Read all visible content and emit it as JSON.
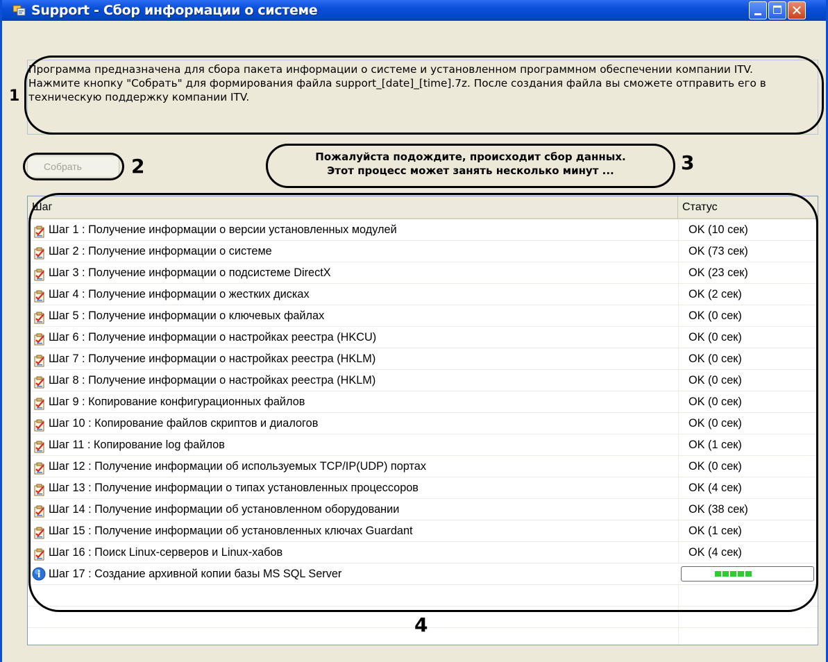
{
  "window": {
    "title": "Support - Сбор информации о системе"
  },
  "description": "Программа предназначена для сбора пакета информации о системе и установленном программном обеспечении компании ITV. Нажмите кнопку \"Собрать\" для формирования файла support_[date]_[time].7z. После создания файла вы сможете отправить его в техническую поддержку компании ITV.",
  "buttons": {
    "collect_label": "Собрать",
    "collect_enabled": false
  },
  "status_message": {
    "line1": "Пожалуйста подождите, происходит сбор данных.",
    "line2": "Этот процесс может занять несколько минут ..."
  },
  "annotations": {
    "n1": "1",
    "n2": "2",
    "n3": "3",
    "n4": "4"
  },
  "table": {
    "columns": [
      "Шаг",
      "Статус"
    ],
    "rows": [
      {
        "step": "Шаг 1 : Получение информации о версии установленных модулей",
        "status": "OK (10 сек)",
        "icon": "checklist-icon"
      },
      {
        "step": "Шаг 2 : Получение информации о системе",
        "status": "OK (73 сек)",
        "icon": "checklist-icon"
      },
      {
        "step": "Шаг 3 : Получение информации о подсистеме DirectX",
        "status": "OK (23 сек)",
        "icon": "checklist-icon"
      },
      {
        "step": "Шаг 4 : Получение информации о жестких дисках",
        "status": "OK (2 сек)",
        "icon": "checklist-icon"
      },
      {
        "step": "Шаг 5 : Получение информации о ключевых файлах",
        "status": "OK (0 сек)",
        "icon": "checklist-icon"
      },
      {
        "step": "Шаг 6 : Получение информации о настройках реестра (HKCU)",
        "status": "OK (0 сек)",
        "icon": "checklist-icon"
      },
      {
        "step": "Шаг 7 : Получение информации о настройках реестра (HKLM)",
        "status": "OK (0 сек)",
        "icon": "checklist-icon"
      },
      {
        "step": "Шаг 8 : Получение информации о настройках реестра (HKLM)",
        "status": "OK (0 сек)",
        "icon": "checklist-icon"
      },
      {
        "step": "Шаг 9 : Копирование конфигурационных файлов",
        "status": "OK (0 сек)",
        "icon": "checklist-icon"
      },
      {
        "step": "Шаг 10 : Копирование файлов скриптов и диалогов",
        "status": "OK (0 сек)",
        "icon": "checklist-icon"
      },
      {
        "step": "Шаг 11 : Копирование log файлов",
        "status": "OK (1 сек)",
        "icon": "checklist-icon"
      },
      {
        "step": "Шаг 12 : Получение информации об используемых TCP/IP(UDP) портах",
        "status": "OK (0 сек)",
        "icon": "checklist-icon"
      },
      {
        "step": "Шаг 13 : Получение информации о типах установленных процессоров",
        "status": "OK (4 сек)",
        "icon": "checklist-icon"
      },
      {
        "step": "Шаг 14 : Получение информации об установленном оборудовании",
        "status": "OK (38 сек)",
        "icon": "checklist-icon"
      },
      {
        "step": "Шаг 15 : Получение информации об установленных ключах Guardant",
        "status": "OK (1 сек)",
        "icon": "checklist-icon"
      },
      {
        "step": "Шаг 16 : Поиск Linux-серверов и Linux-хабов",
        "status": "OK (4 сек)",
        "icon": "checklist-icon"
      }
    ],
    "active_row": {
      "step": "Шаг 17 : Создание архивной копии базы MS SQL Server",
      "icon": "info-icon",
      "progress_blocks": 5
    }
  },
  "colors": {
    "title_bar": "#0a4fd8",
    "progress_fill": "#2bcd2f",
    "window_bg": "#ece9d8"
  }
}
